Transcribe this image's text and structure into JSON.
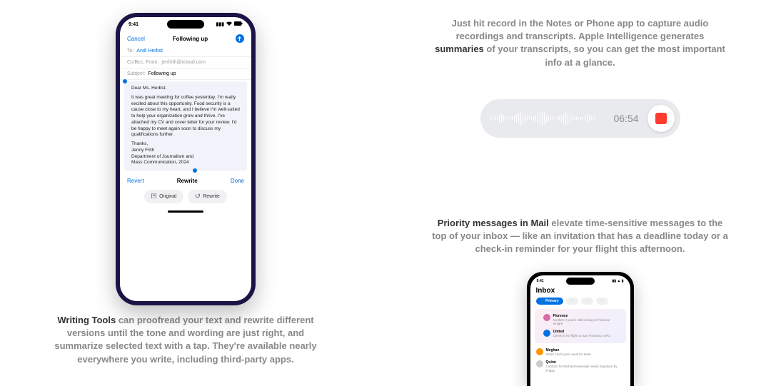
{
  "writing_tools": {
    "status_time": "9:41",
    "nav_cancel": "Cancel",
    "nav_title": "Following up",
    "to_label": "To:",
    "to_value": "Andi Herbst",
    "ccbcc_label": "Cc/Bcc, From:",
    "ccbcc_value": "jenfrith@icloud.com",
    "subject_label": "Subject:",
    "subject_value": "Following up",
    "greeting": "Dear Ms. Herbst,",
    "body": "It was great meeting for coffee yesterday. I'm really excited about this opportunity. Food security is a cause close to my heart, and I believe I'm well-suited to help your organization grow and thrive. I've attached my CV and cover letter for your review. I'd be happy to meet again soon to discuss my qualifications further.",
    "signoff1": "Thanks,",
    "signoff2": "Jenny Frith",
    "signoff3": "Department of Journalism and",
    "signoff4": "Mass Communication, 2024",
    "revert": "Revert",
    "rewrite_title": "Rewrite",
    "done": "Done",
    "pill_original": "Original",
    "pill_rewrite": "Rewrite",
    "caption_bold": "Writing Tools",
    "caption_rest": " can proofread your text and rewrite different versions until the tone and wording are just right, and summarize selected text with a tap. They're available nearly everywhere you write, including third-party apps."
  },
  "recording": {
    "caption_pre": "Just hit record in the Notes or Phone app to capture audio recordings and transcripts. Apple Intelligence generates ",
    "caption_bold": "summaries",
    "caption_post": " of your transcripts, so you can get the most important info at a glance.",
    "time": "06:54"
  },
  "priority": {
    "caption_bold": "Priority messages in Mail",
    "caption_rest": " elevate time-sensitive messages to the top of your inbox — like an invitation that has a deadline today or a check-in reminder for your flight this afternoon.",
    "status_time": "9:41",
    "inbox_title": "Inbox",
    "tab_primary": "Primary",
    "tabs_other": [
      "⋯",
      "⋯",
      "⋯"
    ],
    "items": [
      {
        "name": "Florence",
        "sub": "Confirm if you're still coming to Florence tonight"
      },
      {
        "name": "United",
        "sub": "Check in for flight to San Francisco SFO"
      },
      {
        "name": "Meghan",
        "sub": "Order lunch your usual for team…"
      },
      {
        "name": "Quinn",
        "sub": "Contract for Michael Kawasaki needs signature by Friday"
      }
    ]
  }
}
